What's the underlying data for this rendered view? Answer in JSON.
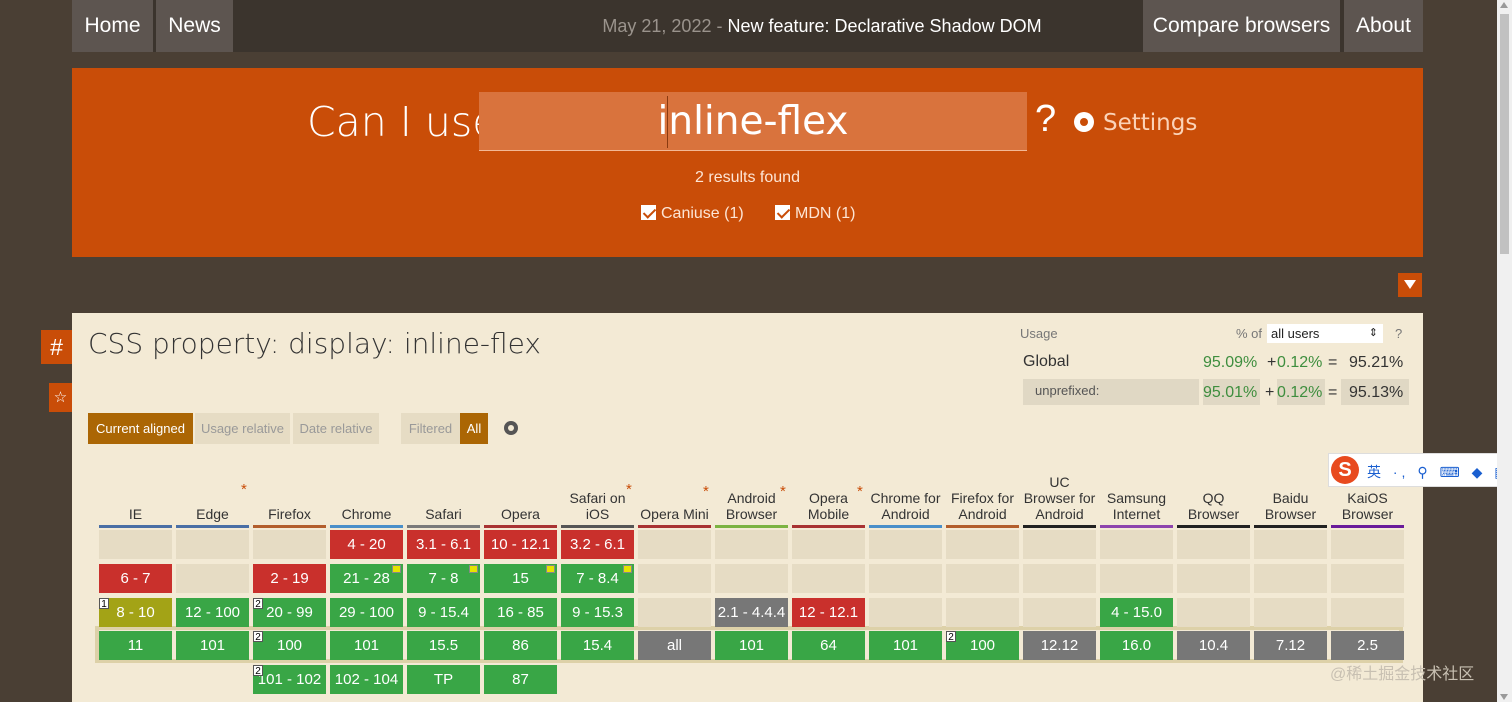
{
  "nav": {
    "home": "Home",
    "news": "News",
    "news_date": "May 21, 2022",
    "news_sep": " - ",
    "news_title": "New feature: Declarative Shadow DOM",
    "compare": "Compare browsers",
    "about": "About"
  },
  "hero": {
    "label": "Can I use",
    "search_value": "inline-flex",
    "qmark": "?",
    "settings": "Settings",
    "results": "2 results found",
    "filter_caniuse": "Caniuse (1)",
    "filter_mdn": "MDN (1)"
  },
  "side": {
    "hash": "#",
    "star": "☆"
  },
  "feature": {
    "title": "CSS property: display: inline-flex",
    "usage_label": "Usage",
    "pct_of": "% of",
    "users_select": "all users",
    "help": "?",
    "global_label": "Global",
    "global_supported": "95.09%",
    "global_plus": "+",
    "global_partial": "0.12%",
    "global_eq": "=",
    "global_total": "95.21%",
    "unpref_label": "unprefixed:",
    "unpref_supported": "95.01%",
    "unpref_plus": "+",
    "unpref_partial": "0.12%",
    "unpref_eq": "=",
    "unpref_total": "95.13%"
  },
  "toggles": {
    "current": "Current aligned",
    "usage": "Usage relative",
    "date": "Date relative",
    "filtered": "Filtered",
    "all": "All"
  },
  "browsers": [
    {
      "name": "IE",
      "color": "#4a6fa5"
    },
    {
      "name": "Edge",
      "color": "#4a6fa5",
      "star": "*"
    },
    {
      "name": "Firefox",
      "color": "#b35e2c"
    },
    {
      "name": "Chrome",
      "color": "#4a8fc9"
    },
    {
      "name": "Safari",
      "color": "#7a7a7a"
    },
    {
      "name": "Opera",
      "color": "#a83232"
    },
    {
      "name": "Safari on iOS",
      "color": "#555555",
      "star": "*"
    },
    {
      "name": "Opera Mini",
      "color": "#a83232",
      "star": "*"
    },
    {
      "name": "Android Browser",
      "color": "#7cb342",
      "star": "*"
    },
    {
      "name": "Opera Mobile",
      "color": "#a83232",
      "star": "*"
    },
    {
      "name": "Chrome for Android",
      "color": "#4a8fc9"
    },
    {
      "name": "Firefox for Android",
      "color": "#b35e2c"
    },
    {
      "name": "UC Browser for Android",
      "color": "#222222"
    },
    {
      "name": "Samsung Internet",
      "color": "#8e44ad"
    },
    {
      "name": "QQ Browser",
      "color": "#222222"
    },
    {
      "name": "Baidu Browser",
      "color": "#222222"
    },
    {
      "name": "KaiOS Browser",
      "color": "#6a1b9a"
    }
  ],
  "rows": [
    [
      null,
      null,
      null,
      {
        "v": "4 - 20",
        "s": "red"
      },
      {
        "v": "3.1 - 6.1",
        "s": "red"
      },
      {
        "v": "10 - 12.1",
        "s": "red"
      },
      {
        "v": "3.2 - 6.1",
        "s": "red"
      },
      null,
      null,
      null,
      null,
      null,
      null,
      null,
      null,
      null,
      null
    ],
    [
      {
        "v": "6 - 7",
        "s": "red"
      },
      null,
      {
        "v": "2 - 19",
        "s": "red"
      },
      {
        "v": "21 - 28",
        "s": "grn",
        "flag": true
      },
      {
        "v": "7 - 8",
        "s": "grn",
        "flag": true
      },
      {
        "v": "15",
        "s": "grn",
        "flag": true
      },
      {
        "v": "7 - 8.4",
        "s": "grn",
        "flag": true
      },
      null,
      null,
      null,
      null,
      null,
      null,
      null,
      null,
      null,
      null
    ],
    [
      {
        "v": "8 - 10",
        "s": "olv",
        "note": "1"
      },
      {
        "v": "12 - 100",
        "s": "grn"
      },
      {
        "v": "20 - 99",
        "s": "grn",
        "note": "2"
      },
      {
        "v": "29 - 100",
        "s": "grn"
      },
      {
        "v": "9 - 15.4",
        "s": "grn"
      },
      {
        "v": "16 - 85",
        "s": "grn"
      },
      {
        "v": "9 - 15.3",
        "s": "grn"
      },
      null,
      {
        "v": "2.1 - 4.4.4",
        "s": "gry"
      },
      {
        "v": "12 - 12.1",
        "s": "red"
      },
      null,
      null,
      null,
      {
        "v": "4 - 15.0",
        "s": "grn"
      },
      null,
      null,
      null
    ],
    [
      {
        "v": "11",
        "s": "grn"
      },
      {
        "v": "101",
        "s": "grn"
      },
      {
        "v": "100",
        "s": "grn",
        "note": "2"
      },
      {
        "v": "101",
        "s": "grn"
      },
      {
        "v": "15.5",
        "s": "grn"
      },
      {
        "v": "86",
        "s": "grn"
      },
      {
        "v": "15.4",
        "s": "grn"
      },
      {
        "v": "all",
        "s": "gry"
      },
      {
        "v": "101",
        "s": "grn"
      },
      {
        "v": "64",
        "s": "grn"
      },
      {
        "v": "101",
        "s": "grn"
      },
      {
        "v": "100",
        "s": "grn",
        "note": "2"
      },
      {
        "v": "12.12",
        "s": "gry"
      },
      {
        "v": "16.0",
        "s": "grn"
      },
      {
        "v": "10.4",
        "s": "gry"
      },
      {
        "v": "7.12",
        "s": "gry"
      },
      {
        "v": "2.5",
        "s": "gry"
      }
    ],
    [
      null,
      null,
      {
        "v": "101 - 102",
        "s": "grn",
        "note": "2"
      },
      {
        "v": "102 - 104",
        "s": "grn"
      },
      {
        "v": "TP",
        "s": "grn"
      },
      {
        "v": "87",
        "s": "grn"
      },
      null,
      null,
      null,
      null,
      null,
      null,
      null,
      null,
      null,
      null,
      null
    ]
  ],
  "ime": {
    "logo": "S",
    "text": "英 ·, ⚲ ⌨ ◆ ▦"
  },
  "watermark": "@稀土掘金技术社区"
}
